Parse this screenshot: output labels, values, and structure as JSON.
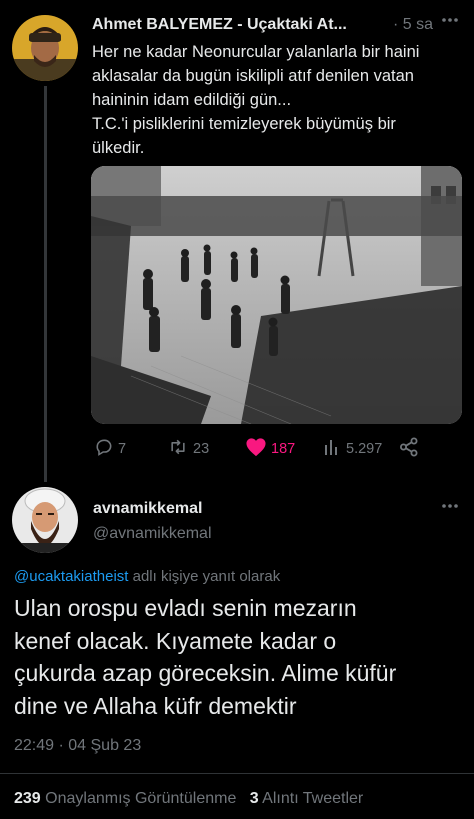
{
  "tweet1": {
    "author": "Ahmet BALYEMEZ - Uçaktaki At...",
    "time": "5 sa",
    "text_lines": [
      "Her ne kadar Neonurcular yalanlarla bir haini",
      "aklasalar da bugün iskilipli atıf denilen vatan",
      "haininin idam edildiği gün...",
      "T.C.'i pisliklerini temizleyerek büyümüş bir",
      "ülkedir."
    ],
    "actions": {
      "replies": "7",
      "retweets": "23",
      "likes": "187",
      "views": "5.297"
    }
  },
  "tweet2": {
    "display_name": "avnamikkemal",
    "handle": "@avnamikkemal",
    "reply_to_handle": "@ucaktakiatheist",
    "reply_to_suffix": " adlı kişiye yanıt olarak",
    "text_lines": [
      "Ulan orospu evladı senin mezarın",
      "kenef olacak. Kıyamete kadar o",
      "çukurda azap göreceksin. Alime küfür",
      "dine ve Allaha küfr demektir"
    ],
    "timestamp": "22:49 · 04 Şub 23",
    "stats": {
      "views_count": "239",
      "views_label": " Onaylanmış Görüntülenme",
      "quotes_count": "3",
      "quotes_label": " Alıntı Tweetler"
    }
  },
  "colors": {
    "background": "#000000",
    "text": "#e7e9ea",
    "muted": "#71767b",
    "link": "#1d9bf0",
    "like": "#f91880"
  },
  "icons": [
    "reply-icon",
    "retweet-icon",
    "heart-icon",
    "views-icon",
    "share-icon",
    "more-icon"
  ]
}
